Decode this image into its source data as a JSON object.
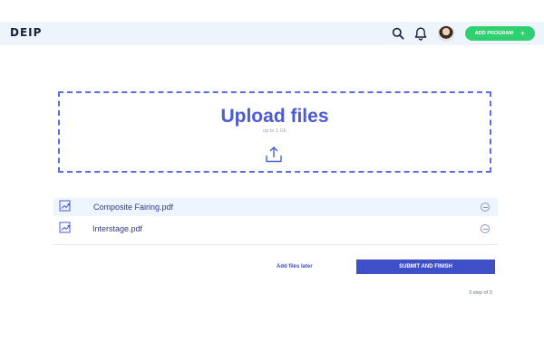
{
  "header": {
    "logo": "DEIP",
    "add_button_label": "ADD PROGRAM",
    "add_button_icon": "+",
    "icons": [
      "search-icon",
      "bell-icon"
    ],
    "accent_color": "#2fd06f"
  },
  "upload": {
    "title": "Upload files",
    "subtitle": "up to 1 Gb",
    "icon": "upload-icon",
    "color": "#4a5ad8"
  },
  "files": [
    {
      "name": "Composite Fairing.pdf",
      "icon": "file-chart-icon",
      "action_icon": "remove-icon"
    },
    {
      "name": "Interstage.pdf",
      "icon": "file-chart-icon",
      "action_icon": "remove-icon"
    }
  ],
  "actions": {
    "later_label": "Add files later",
    "submit_label": "SUBMIT AND FINISH",
    "primary_color": "#3e4fc7"
  },
  "footer": {
    "step": "3 step of 3"
  }
}
